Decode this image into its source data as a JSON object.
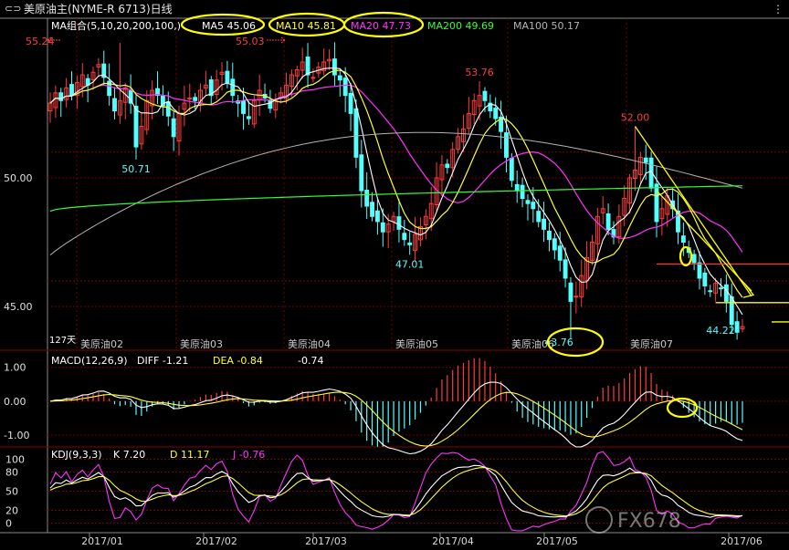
{
  "window": {
    "menu_icon": "chain-link-icon",
    "title": "美原油主(NYME-R 6713)日线",
    "view_icon": "view-options-icon"
  },
  "colors": {
    "up": "#ff3c3c",
    "down": "#54ffff",
    "ma5": "#ffffff",
    "ma10": "#ffff33",
    "ma20": "#ff33ff",
    "ma200": "#33ff33",
    "ma100": "#b4b4b4",
    "highlight": "#ffff00",
    "grid": "#7a0000",
    "level_line": "#ff3333"
  },
  "chart_data": [
    {
      "type": "candlestick",
      "title": "MA组合(5,10,20,200,100,)",
      "legend": [
        {
          "label": "MA5",
          "value": "45.06"
        },
        {
          "label": "MA10",
          "value": "45.81"
        },
        {
          "label": "MA20",
          "value": "47.73"
        },
        {
          "label": "MA200",
          "value": "49.69"
        },
        {
          "label": "MA100",
          "value": "50.17"
        }
      ],
      "ylim": [
        43.3,
        56.2
      ],
      "y_ticks": [
        "50.00",
        "45.00"
      ],
      "month_labels": [
        "美原油02",
        "美原油03",
        "美原油04",
        "美原油05",
        "美原油06",
        "美原油07"
      ],
      "contract_code": "127天",
      "price_labels": [
        "55.24",
        "55.03",
        "53.76",
        "52.00",
        "50.71",
        "47.01",
        "43.76",
        "44.22"
      ],
      "horizontal_levels": [
        46.65,
        45.15
      ],
      "close": [
        52.9,
        53.3,
        53.0,
        53.5,
        53.2,
        53.7,
        54.0,
        53.6,
        54.1,
        54.4,
        53.9,
        53.2,
        52.6,
        53.0,
        53.5,
        52.9,
        51.2,
        52.0,
        53.0,
        53.4,
        53.2,
        52.8,
        52.4,
        51.6,
        52.5,
        52.9,
        53.1,
        53.0,
        53.4,
        53.6,
        53.2,
        53.8,
        54.1,
        53.7,
        53.2,
        52.9,
        52.5,
        52.3,
        53.0,
        53.4,
        53.1,
        52.7,
        53.0,
        53.3,
        53.6,
        54.0,
        54.2,
        54.5,
        54.0,
        53.9,
        54.3,
        54.5,
        54.6,
        54.0,
        53.8,
        53.2,
        52.5,
        50.8,
        49.5,
        48.9,
        48.5,
        48.3,
        47.9,
        48.2,
        48.5,
        48.0,
        47.6,
        47.4,
        47.8,
        48.1,
        48.5,
        49.0,
        50.0,
        50.5,
        50.4,
        51.1,
        51.6,
        51.9,
        52.5,
        53.0,
        53.2,
        53.0,
        52.6,
        52.3,
        51.8,
        50.8,
        49.9,
        49.5,
        49.2,
        49.0,
        48.8,
        48.3,
        48.0,
        47.6,
        47.2,
        46.8,
        46.1,
        45.2,
        45.4,
        46.2,
        46.9,
        47.5,
        48.5,
        48.8,
        48.0,
        47.7,
        48.5,
        49.2,
        50.0,
        50.3,
        50.8,
        50.6,
        49.6,
        48.3,
        48.8,
        49.3,
        48.8,
        47.9,
        47.5,
        47.1,
        46.7,
        46.1,
        45.8,
        45.6,
        45.9,
        45.7,
        45.2,
        44.3,
        44.0,
        44.22
      ],
      "ma5_last": 45.06,
      "ma10_last": 45.81,
      "ma20_last": 47.73,
      "ma200_last": 49.69,
      "ma100_last": 50.17
    },
    {
      "type": "macd",
      "title": "MACD(12,26,9)",
      "legend": [
        {
          "label": "DIFF",
          "value": "-1.21"
        },
        {
          "label": "DEA",
          "value": "-0.84"
        },
        {
          "label": "",
          "value": "-0.74"
        }
      ],
      "y_ticks": [
        "1.00",
        "0.00",
        "-1.00"
      ],
      "ylim": [
        -1.35,
        1.45
      ]
    },
    {
      "type": "kdj",
      "title": "KDJ(9,3,3)",
      "legend": [
        {
          "label": "K",
          "value": "7.20"
        },
        {
          "label": "D",
          "value": "11.17"
        },
        {
          "label": "J",
          "value": "-0.76"
        }
      ],
      "y_ticks": [
        "100",
        "80",
        "50",
        "20",
        "0"
      ],
      "ylim": [
        -15,
        115
      ]
    }
  ],
  "x_axis": {
    "labels": [
      "2017/01",
      "2017/02",
      "2017/03",
      "2017/04",
      "2017/05",
      "2017/06"
    ]
  },
  "watermark": {
    "text": "FX678"
  }
}
